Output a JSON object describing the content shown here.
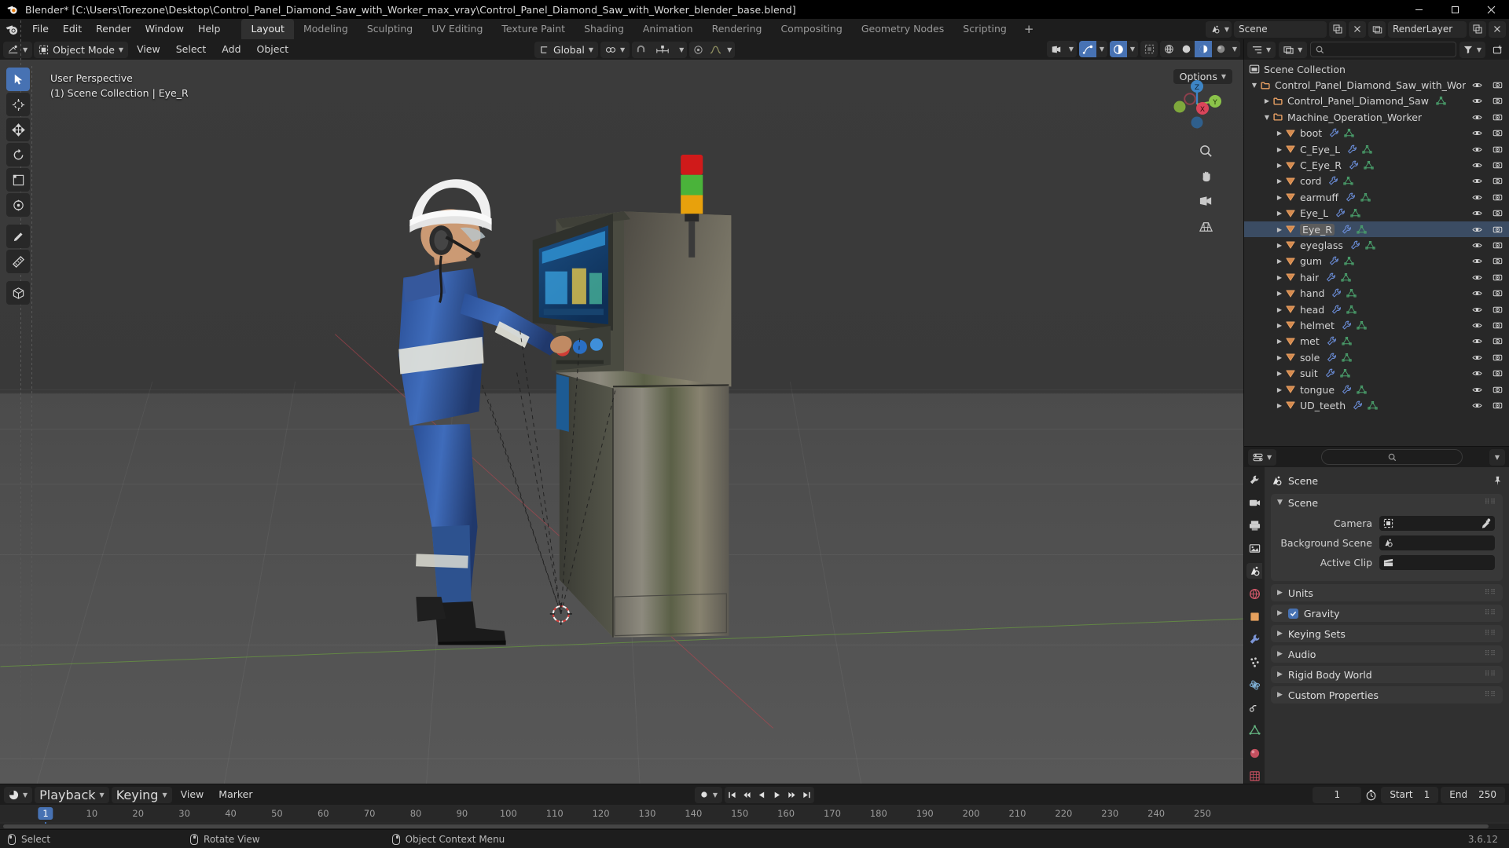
{
  "titlebar": {
    "app": "Blender*",
    "filepath": "[C:\\Users\\Torezone\\Desktop\\Control_Panel_Diamond_Saw_with_Worker_max_vray\\Control_Panel_Diamond_Saw_with_Worker_blender_base.blend]",
    "full": "Blender* [C:\\Users\\Torezone\\Desktop\\Control_Panel_Diamond_Saw_with_Worker_max_vray\\Control_Panel_Diamond_Saw_with_Worker_blender_base.blend]",
    "minimize": "–",
    "maximize": "☐",
    "close": "✕"
  },
  "topbar": {
    "menus": [
      "File",
      "Edit",
      "Render",
      "Window",
      "Help"
    ],
    "workspaces": [
      {
        "label": "Layout",
        "active": true
      },
      {
        "label": "Modeling",
        "active": false
      },
      {
        "label": "Sculpting",
        "active": false
      },
      {
        "label": "UV Editing",
        "active": false
      },
      {
        "label": "Texture Paint",
        "active": false
      },
      {
        "label": "Shading",
        "active": false
      },
      {
        "label": "Animation",
        "active": false
      },
      {
        "label": "Rendering",
        "active": false
      },
      {
        "label": "Compositing",
        "active": false
      },
      {
        "label": "Geometry Nodes",
        "active": false
      },
      {
        "label": "Scripting",
        "active": false
      }
    ],
    "add_workspace": "+",
    "scene_name": "Scene",
    "viewlayer_name": "RenderLayer"
  },
  "viewport_header": {
    "mode": "Object Mode",
    "menus": [
      "View",
      "Select",
      "Add",
      "Object"
    ],
    "transform_orientation": "Global",
    "options_label": "Options"
  },
  "viewport": {
    "perspective": "User Perspective",
    "scene_info": "(1) Scene Collection | Eye_R",
    "gizmo_axes": {
      "x": "X",
      "y": "Y",
      "z": "Z"
    }
  },
  "outliner": {
    "root": "Scene Collection",
    "rows": [
      {
        "label": "Control_Panel_Diamond_Saw_with_Wor",
        "depth": 0,
        "type": "collection",
        "expanded": true,
        "icons": [],
        "selected": false
      },
      {
        "label": "Control_Panel_Diamond_Saw",
        "depth": 1,
        "type": "collection",
        "expanded": false,
        "icons": [
          "mesh"
        ],
        "selected": false
      },
      {
        "label": "Machine_Operation_Worker",
        "depth": 1,
        "type": "collection",
        "expanded": true,
        "icons": [],
        "selected": false
      },
      {
        "label": "boot",
        "depth": 2,
        "type": "object",
        "expanded": false,
        "icons": [
          "modifier",
          "mesh"
        ],
        "selected": false
      },
      {
        "label": "C_Eye_L",
        "depth": 2,
        "type": "object",
        "expanded": false,
        "icons": [
          "modifier",
          "mesh"
        ],
        "selected": false
      },
      {
        "label": "C_Eye_R",
        "depth": 2,
        "type": "object",
        "expanded": false,
        "icons": [
          "modifier",
          "mesh"
        ],
        "selected": false
      },
      {
        "label": "cord",
        "depth": 2,
        "type": "object",
        "expanded": false,
        "icons": [
          "modifier",
          "mesh"
        ],
        "selected": false
      },
      {
        "label": "earmuff",
        "depth": 2,
        "type": "object",
        "expanded": false,
        "icons": [
          "modifier",
          "mesh"
        ],
        "selected": false
      },
      {
        "label": "Eye_L",
        "depth": 2,
        "type": "object",
        "expanded": false,
        "icons": [
          "modifier",
          "mesh"
        ],
        "selected": false
      },
      {
        "label": "Eye_R",
        "depth": 2,
        "type": "object",
        "expanded": false,
        "icons": [
          "modifier",
          "mesh"
        ],
        "selected": true
      },
      {
        "label": "eyeglass",
        "depth": 2,
        "type": "object",
        "expanded": false,
        "icons": [
          "modifier",
          "mesh"
        ],
        "selected": false
      },
      {
        "label": "gum",
        "depth": 2,
        "type": "object",
        "expanded": false,
        "icons": [
          "modifier",
          "mesh"
        ],
        "selected": false
      },
      {
        "label": "hair",
        "depth": 2,
        "type": "object",
        "expanded": false,
        "icons": [
          "modifier",
          "mesh"
        ],
        "selected": false
      },
      {
        "label": "hand",
        "depth": 2,
        "type": "object",
        "expanded": false,
        "icons": [
          "modifier",
          "mesh"
        ],
        "selected": false
      },
      {
        "label": "head",
        "depth": 2,
        "type": "object",
        "expanded": false,
        "icons": [
          "modifier",
          "mesh"
        ],
        "selected": false
      },
      {
        "label": "helmet",
        "depth": 2,
        "type": "object",
        "expanded": false,
        "icons": [
          "modifier",
          "mesh"
        ],
        "selected": false
      },
      {
        "label": "met",
        "depth": 2,
        "type": "object",
        "expanded": false,
        "icons": [
          "modifier",
          "mesh"
        ],
        "selected": false
      },
      {
        "label": "sole",
        "depth": 2,
        "type": "object",
        "expanded": false,
        "icons": [
          "modifier",
          "mesh"
        ],
        "selected": false
      },
      {
        "label": "suit",
        "depth": 2,
        "type": "object",
        "expanded": false,
        "icons": [
          "modifier",
          "mesh"
        ],
        "selected": false
      },
      {
        "label": "tongue",
        "depth": 2,
        "type": "object",
        "expanded": false,
        "icons": [
          "modifier",
          "mesh"
        ],
        "selected": false
      },
      {
        "label": "UD_teeth",
        "depth": 2,
        "type": "object",
        "expanded": false,
        "icons": [
          "modifier",
          "mesh"
        ],
        "selected": false
      }
    ]
  },
  "properties": {
    "breadcrumb": "Scene",
    "panels": [
      {
        "label": "Scene",
        "expanded": true,
        "checkbox": false
      },
      {
        "label": "Units",
        "expanded": false,
        "checkbox": false
      },
      {
        "label": "Gravity",
        "expanded": false,
        "checkbox": true
      },
      {
        "label": "Keying Sets",
        "expanded": false,
        "checkbox": false
      },
      {
        "label": "Audio",
        "expanded": false,
        "checkbox": false
      },
      {
        "label": "Rigid Body World",
        "expanded": false,
        "checkbox": false
      },
      {
        "label": "Custom Properties",
        "expanded": false,
        "checkbox": false
      }
    ],
    "scene_fields": [
      {
        "label": "Camera",
        "value": "",
        "icon": "camera-icon",
        "eyedropper": true
      },
      {
        "label": "Background Scene",
        "value": "",
        "icon": "scene-icon",
        "eyedropper": false
      },
      {
        "label": "Active Clip",
        "value": "",
        "icon": "clip-icon",
        "eyedropper": false
      }
    ]
  },
  "timeline": {
    "menus": [
      "Playback",
      "Keying",
      "View",
      "Marker"
    ],
    "current_frame": "1",
    "start_label": "Start",
    "start_value": "1",
    "end_label": "End",
    "end_value": "250",
    "ticks": [
      "1",
      "10",
      "20",
      "30",
      "40",
      "50",
      "60",
      "70",
      "80",
      "90",
      "100",
      "110",
      "120",
      "130",
      "140",
      "150",
      "160",
      "170",
      "180",
      "190",
      "200",
      "210",
      "220",
      "230",
      "240",
      "250"
    ],
    "playhead_frame": "1"
  },
  "statusbar": {
    "items": [
      {
        "mouse": "left",
        "label": "Select"
      },
      {
        "mouse": "mid",
        "label": "Rotate View"
      },
      {
        "mouse": "right",
        "label": "Object Context Menu"
      }
    ],
    "version": "3.6.12"
  },
  "colors": {
    "accent_blue": "#4772b3",
    "collection_orange": "#e8a063",
    "mesh_green": "#4aa06c",
    "modifier_blue": "#6a8cd6",
    "axis_x": "#d9455a",
    "axis_y": "#8bc34a",
    "axis_z": "#3d85c6"
  }
}
